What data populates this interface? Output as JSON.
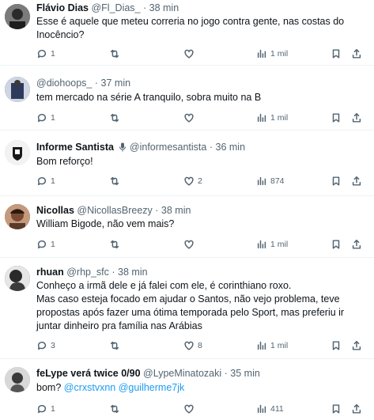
{
  "tweets": [
    {
      "name": "Flávio Dias",
      "handle": "@Fl_Dias_",
      "time": "38 min",
      "lines": [
        "Esse é aquele que meteu correria no jogo contra gente, nas costas do",
        "Inocêncio?"
      ],
      "replies": "1",
      "retweets": "",
      "likes": "",
      "views": "1 mil",
      "avatar_color": "#6a6a6a"
    },
    {
      "name": "",
      "handle": "@diohoops_",
      "time": "37 min",
      "lines": [
        "tem mercado na série A tranquilo, sobra muito na B"
      ],
      "replies": "1",
      "retweets": "",
      "likes": "",
      "views": "1 mil",
      "avatar_color": "#3f4a66"
    },
    {
      "name": "Informe Santista",
      "handle": "@informesantista",
      "time": "36 min",
      "lines": [
        "Bom reforço!"
      ],
      "replies": "1",
      "retweets": "",
      "likes": "2",
      "views": "874",
      "avatar_color": "#d9d9d9"
    },
    {
      "name": "Nicollas",
      "handle": "@NicollasBreezy",
      "time": "38 min",
      "lines": [
        "William Bigode, não vem mais?"
      ],
      "replies": "1",
      "retweets": "",
      "likes": "",
      "views": "1 mil",
      "avatar_color": "#8a5a40"
    },
    {
      "name": "rhuan",
      "handle": "@rhp_sfc",
      "time": "38 min",
      "lines": [
        "Conheço a irmã dele e já falei com ele, é corinthiano roxo.",
        "Mas caso esteja focado em ajudar o Santos, não vejo problema, teve",
        "propostas após fazer uma ótima temporada pelo Sport, mas preferiu ir",
        "juntar dinheiro pra família nas Arábias"
      ],
      "replies": "3",
      "retweets": "",
      "likes": "8",
      "views": "1 mil",
      "avatar_color": "#2a2a2a"
    },
    {
      "name": "feLype verá twice 0/90",
      "handle": "@LypeMinatozaki",
      "time": "35 min",
      "lines_prefix": "bom? ",
      "mentions": "@crxstvxnn @guilherme7jk",
      "replies": "1",
      "retweets": "",
      "likes": "",
      "views": "411",
      "avatar_color": "#9a9a9a"
    }
  ],
  "separator": "·",
  "colors": {
    "text": "#0f1419",
    "secondary": "#536471",
    "link": "#1d9bf0",
    "border": "#eff3f4"
  }
}
